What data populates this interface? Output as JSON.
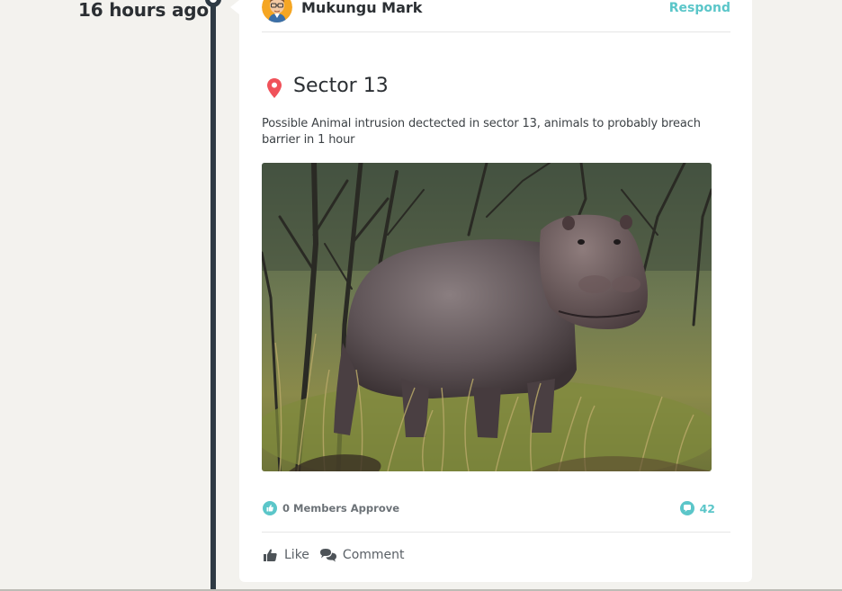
{
  "timeline": {
    "time_label": "16 hours ago"
  },
  "post": {
    "author": "Mukungu Mark",
    "respond_label": "Respond",
    "location": "Sector 13",
    "description": "Possible Animal intrusion dectected in sector 13, animals to probably breach barrier in 1 hour",
    "image_subject": "hippopotamus in grassland",
    "approvals_label": "0 Members Approve",
    "comments_count": "42",
    "actions": {
      "like_label": "Like",
      "comment_label": "Comment"
    }
  },
  "icons": {
    "location": "map-pin-icon",
    "approve": "thumbs-up-icon",
    "comments": "chat-bubble-icon",
    "like": "thumbs-up-icon",
    "comment": "comments-icon"
  },
  "colors": {
    "accent": "#5bc6c9",
    "pin": "#f0525a",
    "timeline": "#2e3a44",
    "background": "#f3f2ee",
    "text": "#2b2f33"
  }
}
